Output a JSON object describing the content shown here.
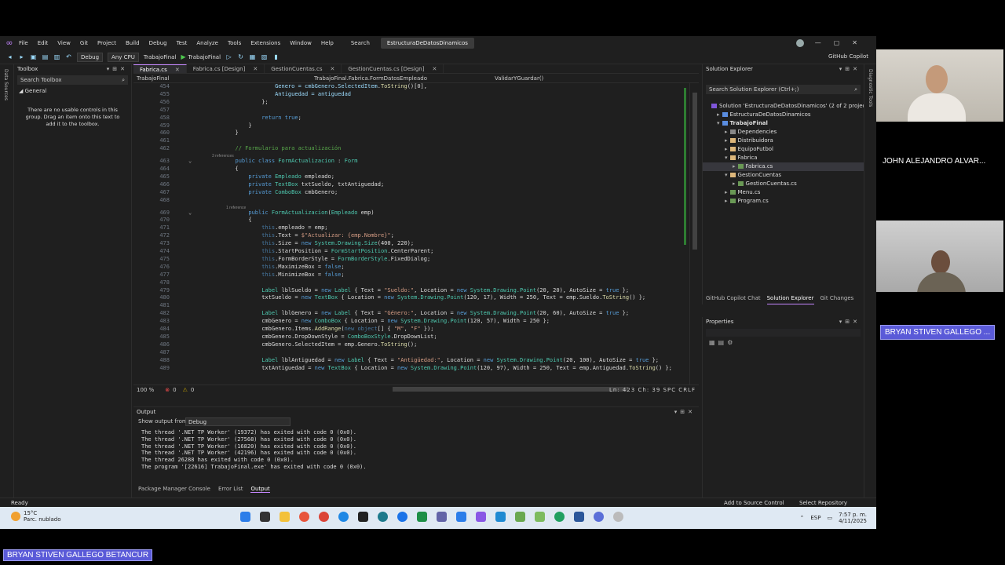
{
  "titlebar": {
    "menu": [
      "File",
      "Edit",
      "View",
      "Git",
      "Project",
      "Build",
      "Debug",
      "Test",
      "Analyze",
      "Tools",
      "Extensions",
      "Window",
      "Help"
    ],
    "search": "Search",
    "project_name": "EstructuraDeDatosDinamicos"
  },
  "toolbar": {
    "config": "Debug",
    "platform": "Any CPU",
    "startup": "TrabajoFinal",
    "run_target": "TrabajoFinal",
    "copilot": "GitHub Copilot"
  },
  "left_strip": "Data Sources",
  "toolbox": {
    "title": "Toolbox",
    "search_placeholder": "Search Toolbox",
    "group": "General",
    "message": "There are no usable controls in this group. Drag an item onto this text to add it to the toolbox."
  },
  "editor": {
    "tabs": [
      {
        "label": "Fabrica.cs",
        "active": true
      },
      {
        "label": "Fabrica.cs [Design]",
        "active": false
      },
      {
        "label": "GestionCuentas.cs",
        "active": false
      },
      {
        "label": "GestionCuentas.cs [Design]",
        "active": false
      }
    ],
    "nav": {
      "project": "TrabajoFinal",
      "class": "TrabajoFinal.Fabrica.FormDatosEmpleado",
      "member": "ValidarYGuardar()"
    },
    "status": {
      "zoom": "100 %",
      "errors": "0",
      "warnings": "0",
      "position": "Ln: 423   Ch: 39   SPC   CRLF"
    }
  },
  "code_lines": [
    {
      "n": "454",
      "segs": [
        [
          "v",
          "                   Genero = "
        ],
        [
          "v",
          "cmbGenero"
        ],
        [
          "p",
          "."
        ],
        [
          "v",
          "SelectedItem"
        ],
        [
          "p",
          "."
        ],
        [
          "m",
          "ToString"
        ],
        [
          "p",
          "()[0],"
        ]
      ]
    },
    {
      "n": "455",
      "segs": [
        [
          "v",
          "                   Antiguedad = "
        ],
        [
          "v",
          "antiguedad"
        ]
      ]
    },
    {
      "n": "456",
      "segs": [
        [
          "p",
          "               };"
        ]
      ]
    },
    {
      "n": "457",
      "segs": [
        [
          "p",
          ""
        ]
      ]
    },
    {
      "n": "458",
      "segs": [
        [
          "k",
          "               return "
        ],
        [
          "k",
          "true"
        ],
        [
          "p",
          ";"
        ]
      ]
    },
    {
      "n": "459",
      "segs": [
        [
          "p",
          "           }"
        ]
      ]
    },
    {
      "n": "460",
      "segs": [
        [
          "p",
          "       }"
        ]
      ]
    },
    {
      "n": "461",
      "segs": [
        [
          "p",
          ""
        ]
      ]
    },
    {
      "n": "462",
      "segs": [
        [
          "c",
          "       // Formulario para actualización"
        ]
      ]
    },
    {
      "n": "463",
      "lens": "3 references",
      "segs": [
        [
          "k",
          "       public class "
        ],
        [
          "t",
          "FormActualizacion"
        ],
        [
          "p",
          " : "
        ],
        [
          "t",
          "Form"
        ]
      ]
    },
    {
      "n": "464",
      "segs": [
        [
          "p",
          "       {"
        ]
      ]
    },
    {
      "n": "465",
      "segs": [
        [
          "k",
          "           private "
        ],
        [
          "t",
          "Empleado "
        ],
        [
          "p",
          "empleado;"
        ]
      ]
    },
    {
      "n": "466",
      "segs": [
        [
          "k",
          "           private "
        ],
        [
          "t",
          "TextBox "
        ],
        [
          "p",
          "txtSueldo, txtAntiguedad;"
        ]
      ]
    },
    {
      "n": "467",
      "segs": [
        [
          "k",
          "           private "
        ],
        [
          "t",
          "ComboBox "
        ],
        [
          "p",
          "cmbGenero;"
        ]
      ]
    },
    {
      "n": "468",
      "segs": [
        [
          "p",
          ""
        ]
      ]
    },
    {
      "n": "469",
      "lens": "1 reference",
      "segs": [
        [
          "k",
          "           public "
        ],
        [
          "t",
          "FormActualizacion"
        ],
        [
          "p",
          "("
        ],
        [
          "t",
          "Empleado "
        ],
        [
          "p",
          "emp)"
        ]
      ]
    },
    {
      "n": "470",
      "segs": [
        [
          "p",
          "           {"
        ]
      ]
    },
    {
      "n": "471",
      "segs": [
        [
          "th",
          "               this"
        ],
        [
          "p",
          ".empleado = emp;"
        ]
      ]
    },
    {
      "n": "472",
      "segs": [
        [
          "th",
          "               this"
        ],
        [
          "p",
          ".Text = "
        ],
        [
          "s",
          "$\"Actualizar: {emp.Nombre}\""
        ],
        [
          "p",
          ";"
        ]
      ]
    },
    {
      "n": "473",
      "segs": [
        [
          "th",
          "               this"
        ],
        [
          "p",
          ".Size = "
        ],
        [
          "k",
          "new "
        ],
        [
          "t",
          "System.Drawing.Size"
        ],
        [
          "p",
          "(400, 220);"
        ]
      ]
    },
    {
      "n": "474",
      "segs": [
        [
          "th",
          "               this"
        ],
        [
          "p",
          ".StartPosition = "
        ],
        [
          "t",
          "FormStartPosition"
        ],
        [
          "p",
          ".CenterParent;"
        ]
      ]
    },
    {
      "n": "475",
      "segs": [
        [
          "th",
          "               this"
        ],
        [
          "p",
          ".FormBorderStyle = "
        ],
        [
          "t",
          "FormBorderStyle"
        ],
        [
          "p",
          ".FixedDialog;"
        ]
      ]
    },
    {
      "n": "476",
      "segs": [
        [
          "th",
          "               this"
        ],
        [
          "p",
          ".MaximizeBox = "
        ],
        [
          "k",
          "false"
        ],
        [
          "p",
          ";"
        ]
      ]
    },
    {
      "n": "477",
      "segs": [
        [
          "th",
          "               this"
        ],
        [
          "p",
          ".MinimizeBox = "
        ],
        [
          "k",
          "false"
        ],
        [
          "p",
          ";"
        ]
      ]
    },
    {
      "n": "478",
      "segs": [
        [
          "p",
          ""
        ]
      ]
    },
    {
      "n": "479",
      "segs": [
        [
          "t",
          "               Label "
        ],
        [
          "p",
          "lblSueldo = "
        ],
        [
          "k",
          "new "
        ],
        [
          "t",
          "Label "
        ],
        [
          "p",
          "{ Text = "
        ],
        [
          "s",
          "\"Sueldo:\""
        ],
        [
          "p",
          ", Location = "
        ],
        [
          "k",
          "new "
        ],
        [
          "t",
          "System.Drawing.Point"
        ],
        [
          "p",
          "(20, 20), AutoSize = "
        ],
        [
          "k",
          "true"
        ],
        [
          "p",
          " };"
        ]
      ]
    },
    {
      "n": "480",
      "segs": [
        [
          "p",
          "               txtSueldo = "
        ],
        [
          "k",
          "new "
        ],
        [
          "t",
          "TextBox "
        ],
        [
          "p",
          "{ Location = "
        ],
        [
          "k",
          "new "
        ],
        [
          "t",
          "System.Drawing.Point"
        ],
        [
          "p",
          "(120, 17), Width = 250, Text = emp.Sueldo."
        ],
        [
          "m",
          "ToString"
        ],
        [
          "p",
          "() };"
        ]
      ]
    },
    {
      "n": "481",
      "segs": [
        [
          "p",
          ""
        ]
      ]
    },
    {
      "n": "482",
      "segs": [
        [
          "t",
          "               Label "
        ],
        [
          "p",
          "lblGenero = "
        ],
        [
          "k",
          "new "
        ],
        [
          "t",
          "Label "
        ],
        [
          "p",
          "{ Text = "
        ],
        [
          "s",
          "\"Género:\""
        ],
        [
          "p",
          ", Location = "
        ],
        [
          "k",
          "new "
        ],
        [
          "t",
          "System.Drawing.Point"
        ],
        [
          "p",
          "(20, 60), AutoSize = "
        ],
        [
          "k",
          "true"
        ],
        [
          "p",
          " };"
        ]
      ]
    },
    {
      "n": "483",
      "segs": [
        [
          "p",
          "               cmbGenero = "
        ],
        [
          "k",
          "new "
        ],
        [
          "t",
          "ComboBox "
        ],
        [
          "p",
          "{ Location = "
        ],
        [
          "k",
          "new "
        ],
        [
          "t",
          "System.Drawing.Point"
        ],
        [
          "p",
          "(120, 57), Width = 250 };"
        ]
      ]
    },
    {
      "n": "484",
      "segs": [
        [
          "p",
          "               cmbGenero.Items."
        ],
        [
          "m",
          "AddRange"
        ],
        [
          "p",
          "("
        ],
        [
          "th",
          "new object"
        ],
        [
          "p",
          "[] { "
        ],
        [
          "s",
          "\"M\""
        ],
        [
          "p",
          ", "
        ],
        [
          "s",
          "\"F\""
        ],
        [
          "p",
          " });"
        ]
      ]
    },
    {
      "n": "485",
      "segs": [
        [
          "p",
          "               cmbGenero.DropDownStyle = "
        ],
        [
          "t",
          "ComboBoxStyle"
        ],
        [
          "p",
          ".DropDownList;"
        ]
      ]
    },
    {
      "n": "486",
      "segs": [
        [
          "p",
          "               cmbGenero.SelectedItem = emp.Genero."
        ],
        [
          "m",
          "ToString"
        ],
        [
          "p",
          "();"
        ]
      ]
    },
    {
      "n": "487",
      "segs": [
        [
          "p",
          ""
        ]
      ]
    },
    {
      "n": "488",
      "segs": [
        [
          "t",
          "               Label "
        ],
        [
          "p",
          "lblAntiguedad = "
        ],
        [
          "k",
          "new "
        ],
        [
          "t",
          "Label "
        ],
        [
          "p",
          "{ Text = "
        ],
        [
          "s",
          "\"Antigüedad:\""
        ],
        [
          "p",
          ", Location = "
        ],
        [
          "k",
          "new "
        ],
        [
          "t",
          "System.Drawing.Point"
        ],
        [
          "p",
          "(20, 100), AutoSize = "
        ],
        [
          "k",
          "true"
        ],
        [
          "p",
          " };"
        ]
      ]
    },
    {
      "n": "489",
      "segs": [
        [
          "p",
          "               txtAntiguedad = "
        ],
        [
          "k",
          "new "
        ],
        [
          "t",
          "TextBox "
        ],
        [
          "p",
          "{ Location = "
        ],
        [
          "k",
          "new "
        ],
        [
          "t",
          "System.Drawing.Point"
        ],
        [
          "p",
          "(120, 97), Width = 250, Text = emp.Antiguedad."
        ],
        [
          "m",
          "ToString"
        ],
        [
          "p",
          "() };"
        ]
      ]
    }
  ],
  "output": {
    "title": "Output",
    "from_label": "Show output from:",
    "from_value": "Debug",
    "lines": [
      "The thread '.NET TP Worker' (19372) has exited with code 0 (0x0).",
      "The thread '.NET TP Worker' (27568) has exited with code 0 (0x0).",
      "The thread '.NET TP Worker' (16820) has exited with code 0 (0x0).",
      "The thread '.NET TP Worker' (42196) has exited with code 0 (0x0).",
      "The thread 26288 has exited with code 0 (0x0).",
      "The program '[22616] TrabajoFinal.exe' has exited with code 0 (0x0)."
    ],
    "tabs": [
      "Package Manager Console",
      "Error List",
      "Output"
    ]
  },
  "solution": {
    "title": "Solution Explorer",
    "search_placeholder": "Search Solution Explorer (Ctrl+;)",
    "tree": [
      {
        "label": "Solution 'EstructuraDeDatosDinamicos' (2 of 2 projects)",
        "depth": 0,
        "icon": "sol",
        "arrow": ""
      },
      {
        "label": "EstructuraDeDatosDinamicos",
        "depth": 1,
        "icon": "proj",
        "arrow": "▸"
      },
      {
        "label": "TrabajoFinal",
        "depth": 1,
        "icon": "proj",
        "arrow": "▾",
        "bold": true
      },
      {
        "label": "Dependencies",
        "depth": 2,
        "icon": "dep",
        "arrow": "▸"
      },
      {
        "label": "Distribuidora",
        "depth": 2,
        "icon": "fold",
        "arrow": "▸"
      },
      {
        "label": "EquipoFutbol",
        "depth": 2,
        "icon": "fold",
        "arrow": "▸"
      },
      {
        "label": "Fabrica",
        "depth": 2,
        "icon": "fold",
        "arrow": "▾"
      },
      {
        "label": "Fabrica.cs",
        "depth": 3,
        "icon": "cs",
        "arrow": "▸",
        "selected": true
      },
      {
        "label": "GestionCuentas",
        "depth": 2,
        "icon": "fold",
        "arrow": "▾"
      },
      {
        "label": "GestionCuentas.cs",
        "depth": 3,
        "icon": "cs",
        "arrow": "▸"
      },
      {
        "label": "Menu.cs",
        "depth": 2,
        "icon": "cs",
        "arrow": "▸"
      },
      {
        "label": "Program.cs",
        "depth": 2,
        "icon": "cs",
        "arrow": "▸"
      }
    ],
    "tabs": [
      "GitHub Copilot Chat",
      "Solution Explorer",
      "Git Changes"
    ]
  },
  "properties": {
    "title": "Properties"
  },
  "right_strip": "Diagnostic Tools",
  "statusbar": {
    "ready": "Ready",
    "source_control": "Add to Source Control",
    "repository": "Select Repository"
  },
  "taskbar": {
    "temp": "15°C",
    "weather": "Parc. nublado",
    "lang": "ESP",
    "time": "7:57 p. m.",
    "date": "4/11/2025"
  },
  "participants": {
    "p1": "JOHN ALEJANDRO ALVAR...",
    "p2": "BRYAN STIVEN GALLEGO ...",
    "bottom": "BRYAN STIVEN GALLEGO BETANCUR"
  },
  "colors": {
    "accent": "#c586ff",
    "keyword": "#569cd6",
    "type": "#4ec9b0",
    "string": "#d69d85",
    "comment": "#57a64a",
    "highlight": "#5a5ad8"
  }
}
